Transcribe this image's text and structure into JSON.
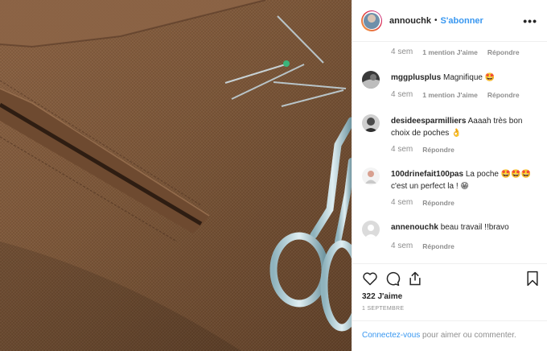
{
  "post": {
    "owner": "annouchk",
    "separator": "•",
    "follow_label": "S'abonner",
    "more_icon": "•••"
  },
  "first_meta": {
    "time": "4 sem",
    "mentions": "1 mention J'aime",
    "reply": "Répondre"
  },
  "comments": [
    {
      "user": "mggplusplus",
      "text": "Magnifique 🤩",
      "time": "4 sem",
      "mentions": "1 mention J'aime",
      "reply": "Répondre"
    },
    {
      "user": "desideesparmilliers",
      "text": "Aaaah très bon choix de poches 👌",
      "time": "4 sem",
      "reply": "Répondre"
    },
    {
      "user": "100drinefait100pas",
      "text": "La poche 🤩🤩🤩 c'est un perfect la ! 😁",
      "time": "4 sem",
      "reply": "Répondre"
    },
    {
      "user": "annenouchk",
      "text": "beau travail !!bravo",
      "time": "4 sem",
      "reply": "Répondre"
    }
  ],
  "likes": "322 J'aime",
  "date": "1 SEPTEMBRE",
  "login": {
    "link": "Connectez-vous",
    "rest": " pour aimer ou commenter."
  },
  "icons": [
    "heart-icon",
    "comment-icon",
    "share-icon",
    "bookmark-icon"
  ],
  "colors": {
    "accent": "#3897f0",
    "muted": "#8e8e8e",
    "text": "#262626",
    "fabric": "#7a5436"
  }
}
